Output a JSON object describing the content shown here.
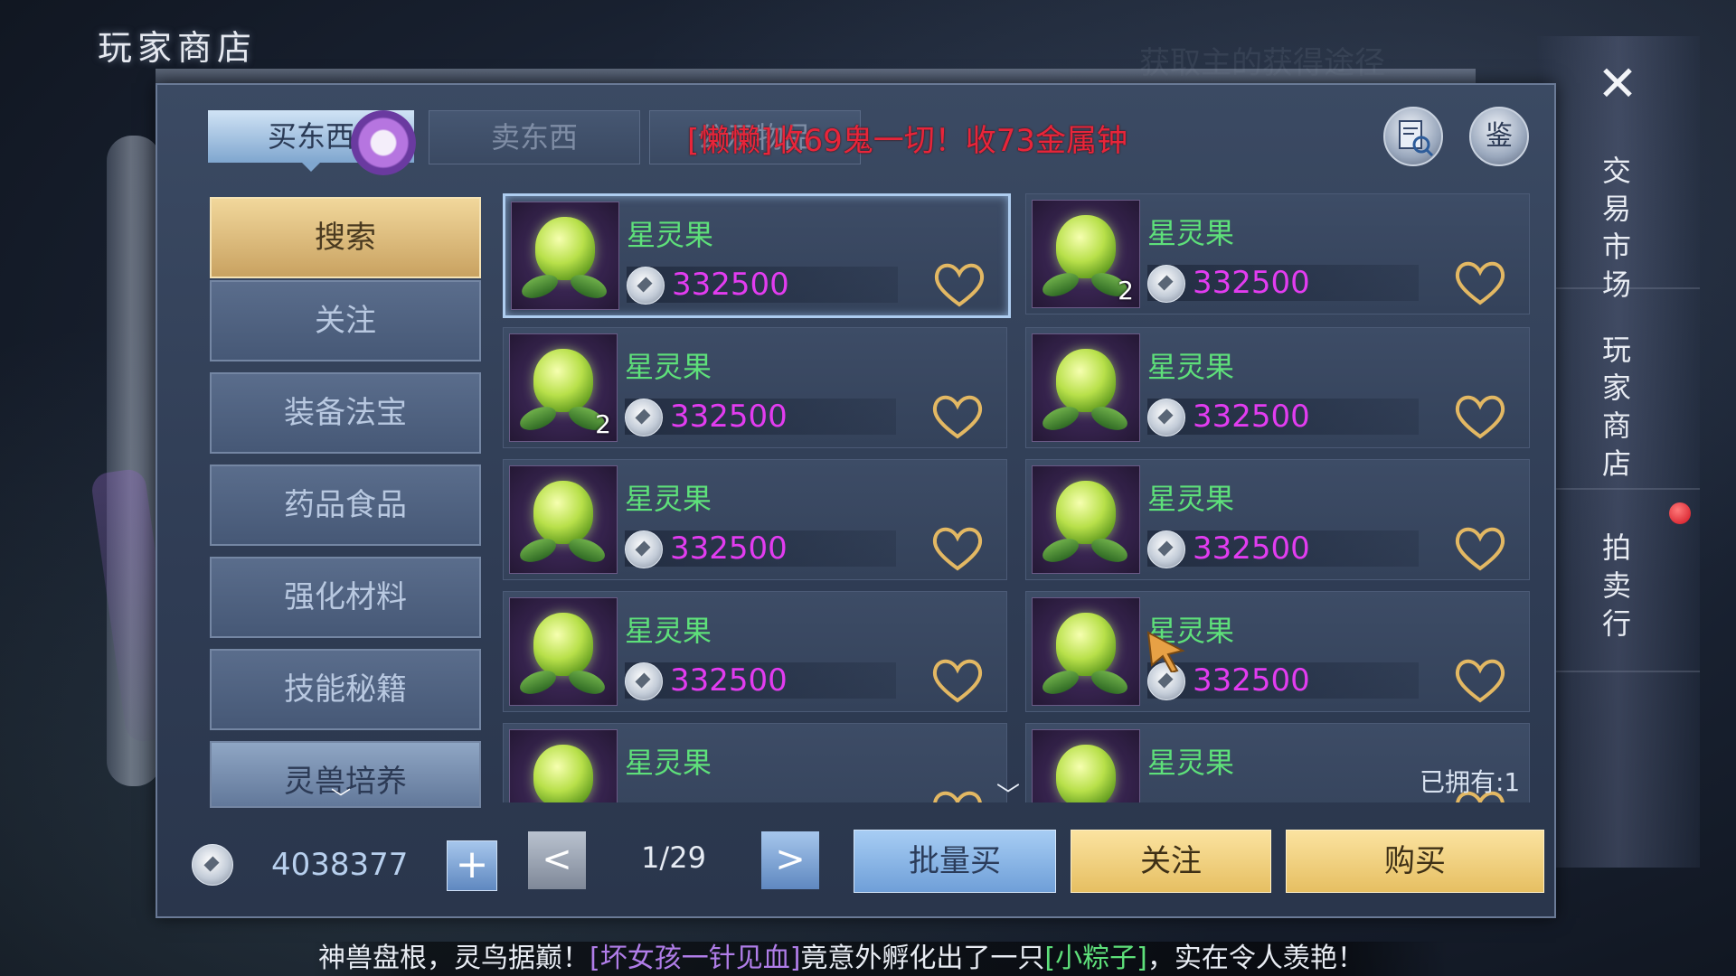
{
  "header": {
    "title": "玩家商店",
    "faded_text": "获取主的获得途径"
  },
  "tabs": [
    {
      "label": "买东西",
      "active": true
    },
    {
      "label": "卖东西",
      "active": false
    },
    {
      "label": "公示物品",
      "active": false
    }
  ],
  "broadcast": "[懒懒]收69鬼一切！收73金属钟",
  "toolbar": {
    "appraise_label": "鉴",
    "trade_icon": "magnifier-ledger-icon"
  },
  "right_nav": [
    {
      "label": "交易市场"
    },
    {
      "label": "玩家商店"
    },
    {
      "label": "拍卖行"
    }
  ],
  "categories": [
    {
      "label": "搜索",
      "active": true
    },
    {
      "label": "关注"
    },
    {
      "label": "装备法宝"
    },
    {
      "label": "药品食品"
    },
    {
      "label": "强化材料"
    },
    {
      "label": "技能秘籍"
    },
    {
      "label": "灵兽培养"
    }
  ],
  "items": [
    {
      "name": "星灵果",
      "price": "332500",
      "qty": "",
      "selected": true
    },
    {
      "name": "星灵果",
      "price": "332500",
      "qty": "2"
    },
    {
      "name": "星灵果",
      "price": "332500",
      "qty": "2"
    },
    {
      "name": "星灵果",
      "price": "332500",
      "qty": ""
    },
    {
      "name": "星灵果",
      "price": "332500",
      "qty": ""
    },
    {
      "name": "星灵果",
      "price": "332500",
      "qty": ""
    },
    {
      "name": "星灵果",
      "price": "332500",
      "qty": ""
    },
    {
      "name": "星灵果",
      "price": "332500",
      "qty": ""
    },
    {
      "name": "星灵果",
      "price": "",
      "qty": ""
    },
    {
      "name": "星灵果",
      "price": "",
      "qty": ""
    }
  ],
  "owned": "已拥有:1",
  "footer": {
    "balance": "4038377",
    "add_label": "+",
    "prev_label": "<",
    "next_label": ">",
    "page": "1/29",
    "bulk_buy_label": "批量买",
    "follow_label": "关注",
    "buy_label": "购买"
  },
  "ticker": {
    "prefix": "神兽盘根，灵鸟据巅！",
    "player": "[坏女孩一针见血]",
    "middle": "竟意外孵化出了一只",
    "pet": "[小粽子]",
    "suffix": "，实在令人羡艳！"
  },
  "colors": {
    "item_name": "#5ee07a",
    "price": "#e23cf0",
    "broadcast": "#e8253a",
    "active_category": "#e6c27a"
  }
}
